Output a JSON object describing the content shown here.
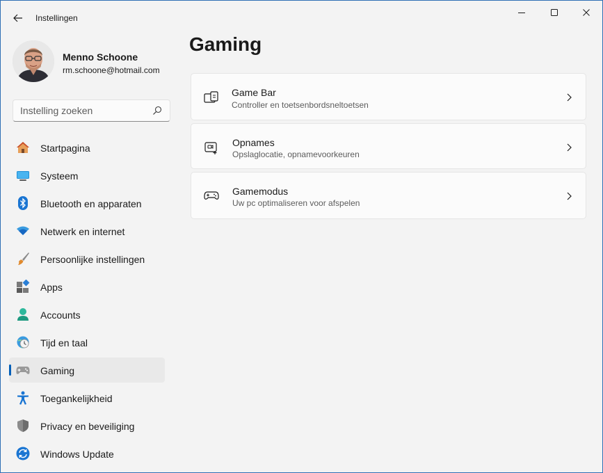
{
  "window": {
    "app_title": "Instellingen"
  },
  "profile": {
    "name": "Menno Schoone",
    "email": "rm.schoone@hotmail.com"
  },
  "search": {
    "placeholder": "Instelling zoeken",
    "value": ""
  },
  "sidebar": {
    "items": [
      {
        "label": "Startpagina",
        "icon": "home-icon"
      },
      {
        "label": "Systeem",
        "icon": "system-icon"
      },
      {
        "label": "Bluetooth en apparaten",
        "icon": "bluetooth-icon"
      },
      {
        "label": "Netwerk en internet",
        "icon": "wifi-icon"
      },
      {
        "label": "Persoonlijke instellingen",
        "icon": "brush-icon"
      },
      {
        "label": "Apps",
        "icon": "apps-icon"
      },
      {
        "label": "Accounts",
        "icon": "accounts-icon"
      },
      {
        "label": "Tijd en taal",
        "icon": "globe-clock-icon"
      },
      {
        "label": "Gaming",
        "icon": "gamepad-icon",
        "active": true
      },
      {
        "label": "Toegankelijkheid",
        "icon": "accessibility-icon"
      },
      {
        "label": "Privacy en beveiliging",
        "icon": "shield-icon"
      },
      {
        "label": "Windows Update",
        "icon": "update-icon"
      }
    ]
  },
  "main": {
    "title": "Gaming",
    "cards": [
      {
        "title": "Game Bar",
        "subtitle": "Controller en toetsenbordsneltoetsen",
        "icon": "game-bar-icon"
      },
      {
        "title": "Opnames",
        "subtitle": "Opslaglocatie, opnamevoorkeuren",
        "icon": "capture-icon"
      },
      {
        "title": "Gamemodus",
        "subtitle": "Uw pc optimaliseren voor afspelen",
        "icon": "game-mode-icon"
      }
    ]
  },
  "colors": {
    "accent": "#005fb8",
    "window_bg": "#f3f3f3",
    "card_bg": "#fbfbfb",
    "border": "#2f6fb5"
  }
}
